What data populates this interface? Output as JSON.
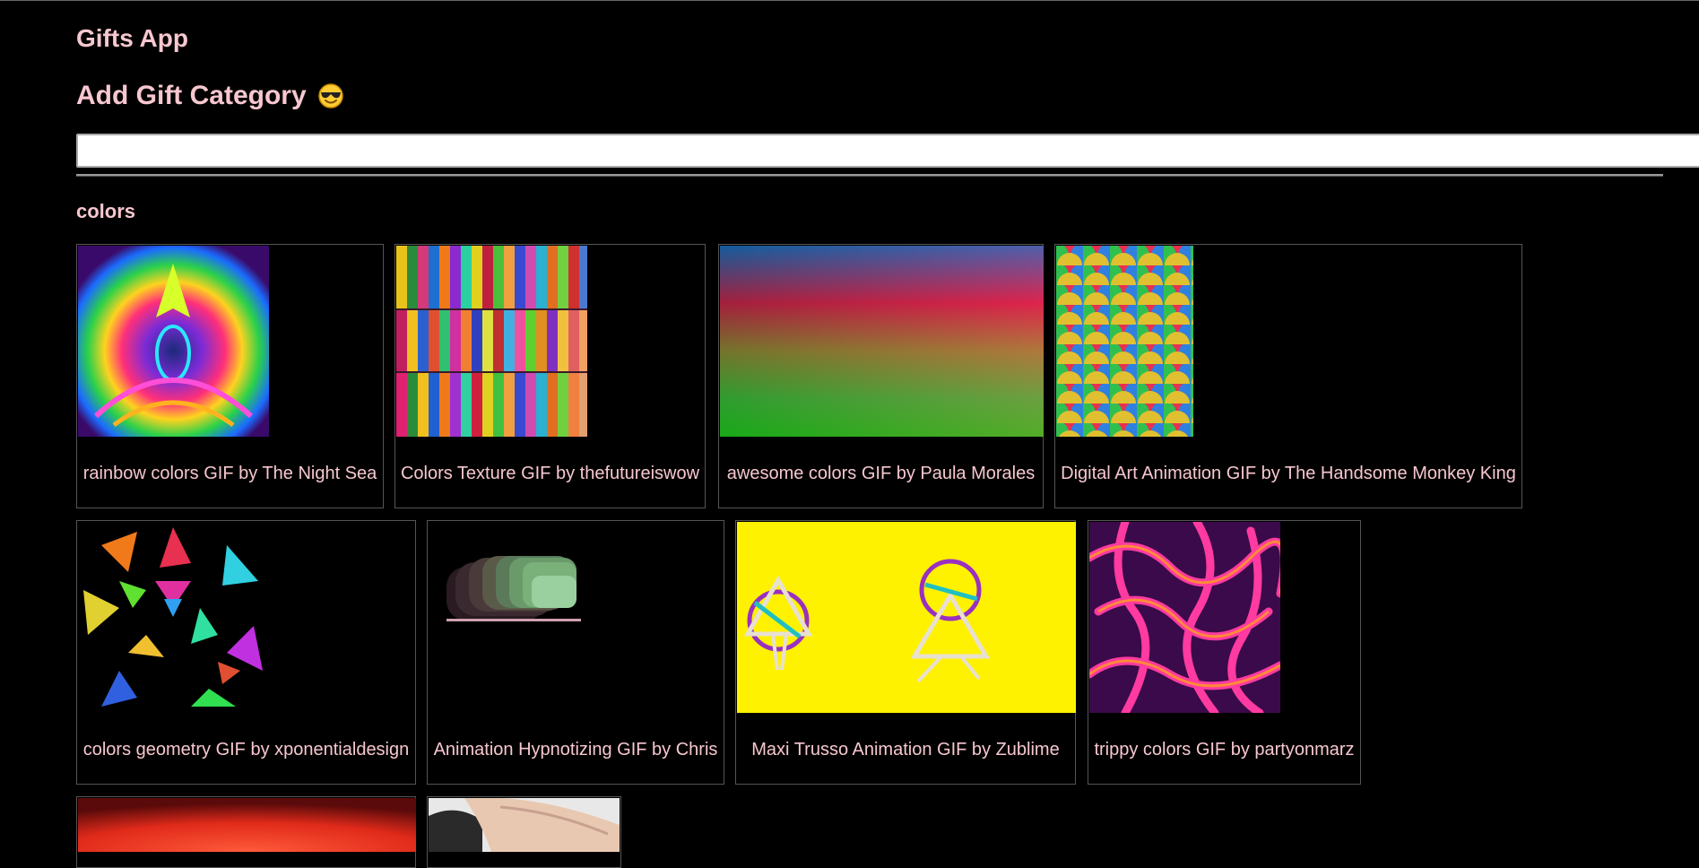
{
  "header": {
    "app_title": "Gifts App",
    "add_category_title": "Add Gift Category",
    "emoji_icon": "smiling-face-with-sunglasses-icon"
  },
  "search": {
    "value": "",
    "placeholder": ""
  },
  "category": {
    "name": "colors",
    "gifs": [
      {
        "title": "rainbow colors GIF by The Night Sea",
        "icon": "rainbow-kaleidoscope-gif"
      },
      {
        "title": "Colors Texture GIF by thefutureiswow",
        "icon": "woven-texture-gif"
      },
      {
        "title": "awesome colors GIF by Paula Morales",
        "icon": "gradient-gif"
      },
      {
        "title": "Digital Art Animation GIF by The Handsome Monkey King",
        "icon": "scales-pattern-gif"
      },
      {
        "title": "colors geometry GIF by xponentialdesign",
        "icon": "geometry-tunnel-gif"
      },
      {
        "title": "Animation Hypnotizing GIF by Chris",
        "icon": "stacked-squares-gif"
      },
      {
        "title": "Maxi Trusso Animation GIF by Zublime",
        "icon": "stick-figures-gif"
      },
      {
        "title": "trippy colors GIF by partyonmarz",
        "icon": "trippy-veins-gif"
      },
      {
        "title": "",
        "icon": "red-glow-gif"
      },
      {
        "title": "",
        "icon": "hand-photo-gif"
      }
    ]
  },
  "colors": {
    "background": "#000000",
    "text": "#f7c7cf",
    "border": "#555555"
  }
}
